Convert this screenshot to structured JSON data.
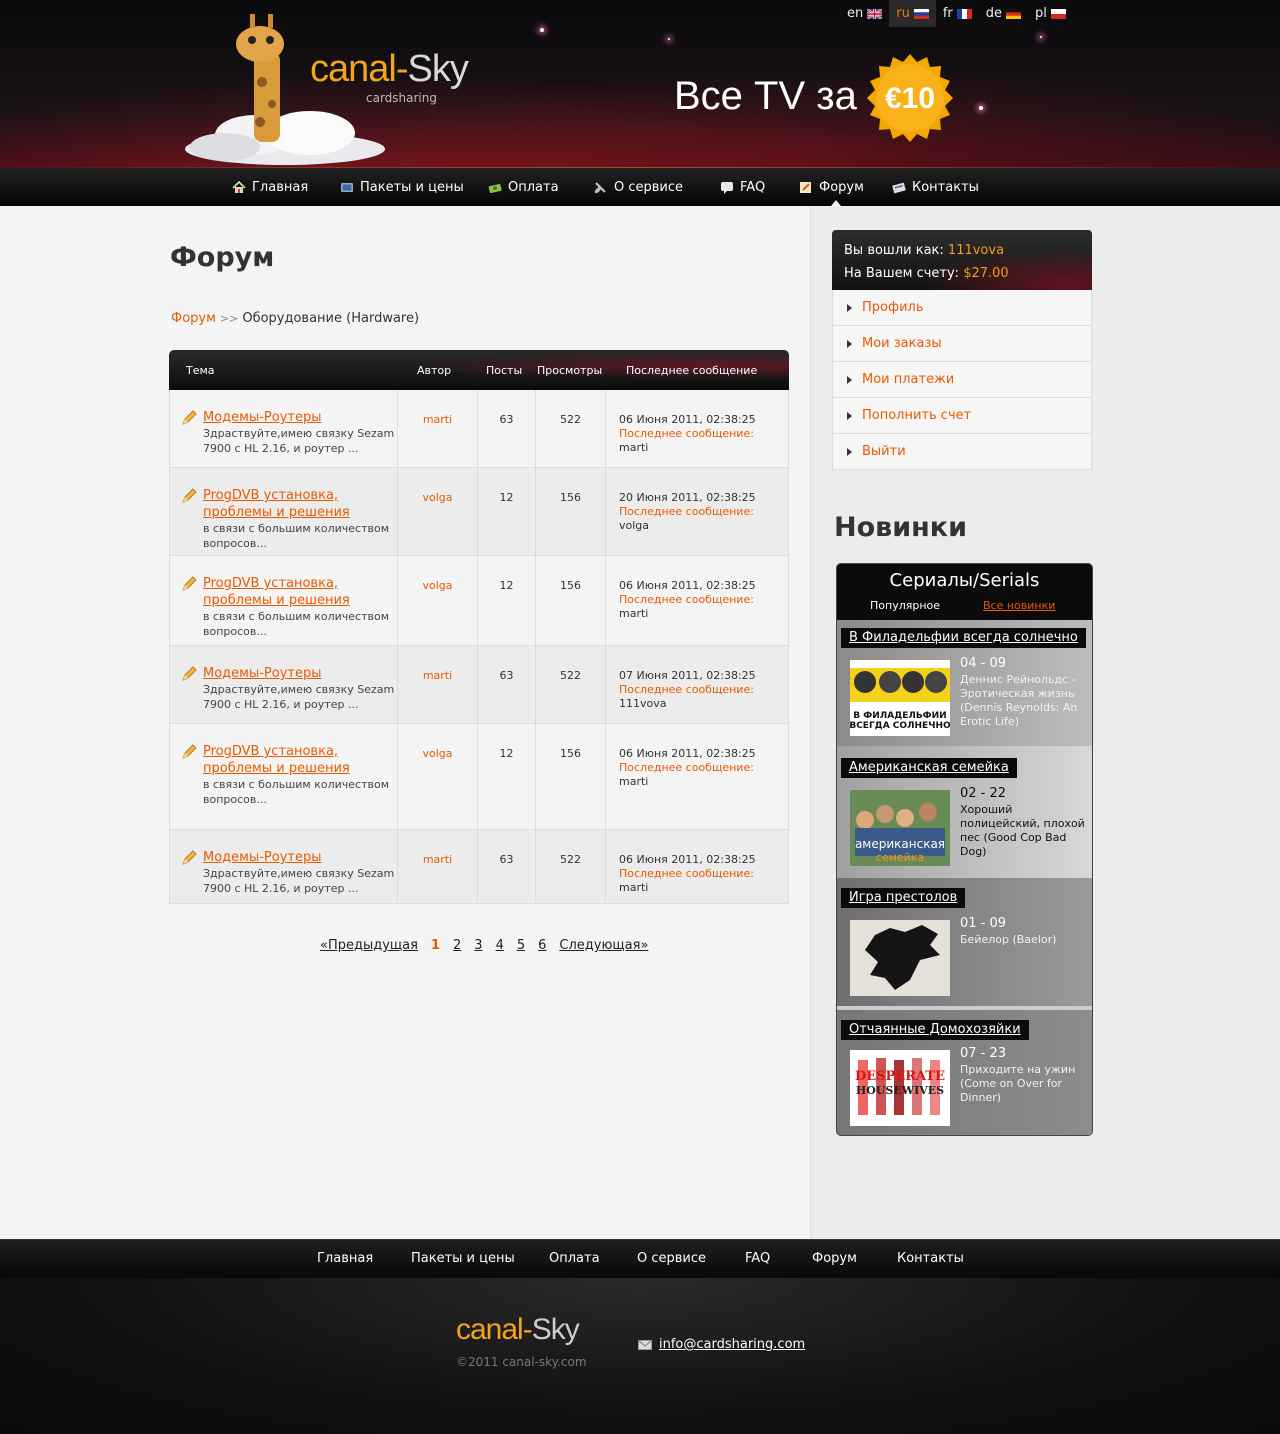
{
  "header": {
    "logo_main": "canal-",
    "logo_accent": "Sky",
    "logo_sub": "cardsharing",
    "promo_text": "Все TV за",
    "price_badge": "€10",
    "languages": [
      {
        "code": "en",
        "active": false
      },
      {
        "code": "ru",
        "active": true
      },
      {
        "code": "fr",
        "active": false
      },
      {
        "code": "de",
        "active": false
      },
      {
        "code": "pl",
        "active": false
      }
    ]
  },
  "nav": {
    "items": [
      {
        "label": "Главная",
        "icon": "home-icon"
      },
      {
        "label": "Пакеты и цены",
        "icon": "tv-icon"
      },
      {
        "label": "Оплата",
        "icon": "money-icon"
      },
      {
        "label": "О сервисе",
        "icon": "satellite-icon"
      },
      {
        "label": "FAQ",
        "icon": "faq-icon"
      },
      {
        "label": "Форум",
        "icon": "forum-icon",
        "active": true
      },
      {
        "label": "Контакты",
        "icon": "contacts-icon"
      }
    ]
  },
  "main": {
    "title": "Форум",
    "breadcrumb": {
      "root": "Форум",
      "sep": ">>",
      "current": "Оборудование (Hardware)"
    },
    "table": {
      "headers": {
        "topic": "Тема",
        "author": "Автор",
        "posts": "Посты",
        "views": "Просмотры",
        "last": "Последнее сообщение"
      },
      "rows": [
        {
          "title": "Модемы-Роутеры",
          "desc": "Здраствуйте,имею связку Sezam 7900 с HL 2.16, и роутер ...",
          "author": "marti",
          "posts": "63",
          "views": "522",
          "date": "06 Июня 2011, 02:38:25",
          "last_label": "Последнее сообщение:",
          "last_user": "marti"
        },
        {
          "title": "ProgDVB установка, проблемы и решения",
          "desc": "в связи с большим количеством вопросов...",
          "author": "volga",
          "posts": "12",
          "views": "156",
          "date": "20 Июня 2011, 02:38:25",
          "last_label": "Последнее сообщение:",
          "last_user": "volga"
        },
        {
          "title": "ProgDVB установка, проблемы и решения",
          "desc": "в связи с большим количеством вопросов...",
          "author": "volga",
          "posts": "12",
          "views": "156",
          "date": "06 Июня 2011, 02:38:25",
          "last_label": "Последнее сообщение:",
          "last_user": "marti"
        },
        {
          "title": "Модемы-Роутеры",
          "desc": "Здраствуйте,имею связку Sezam 7900 с HL 2.16, и роутер ...",
          "author": "marti",
          "posts": "63",
          "views": "522",
          "date": "07 Июня 2011, 02:38:25",
          "last_label": "Последнее сообщение:",
          "last_user": "111vova"
        },
        {
          "title": "ProgDVB установка, проблемы и решения",
          "desc": "в связи с большим количеством вопросов...",
          "author": "volga",
          "posts": "12",
          "views": "156",
          "date": "06 Июня 2011, 02:38:25",
          "last_label": "Последнее сообщение:",
          "last_user": "marti"
        },
        {
          "title": "Модемы-Роутеры",
          "desc": "Здраствуйте,имею связку Sezam 7900 с HL 2.16, и роутер ...",
          "author": "marti",
          "posts": "63",
          "views": "522",
          "date": "06 Июня 2011, 02:38:25",
          "last_label": "Последнее сообщение:",
          "last_user": "marti"
        }
      ]
    },
    "pager": {
      "prev": "«Предыдущая",
      "pages": [
        "1",
        "2",
        "3",
        "4",
        "5",
        "6"
      ],
      "current": "1",
      "next": "Следующая»"
    }
  },
  "sidebar": {
    "account": {
      "logged_label": "Вы вошли как:",
      "user": "111vova",
      "balance_label": "На Вашем счету:",
      "balance": "$27.00"
    },
    "menu": [
      "Профиль",
      "Мои заказы",
      "Мои платежи",
      "Пополнить счет",
      "Выйти"
    ],
    "new_title": "Новинки",
    "serials": {
      "title": "Сериалы/Serials",
      "tab_popular": "Популярное",
      "tab_new": "Все новинки",
      "items": [
        {
          "title": "В Филадельфии всегда солнечно",
          "episode": "04 - 09",
          "name": "Деннис Рейнольдс - Эротическая жизнь (Dennis Reynolds: An Erotic Life)",
          "poster_text": "В ФИЛАДЕЛЬФИИ ВСЕГДА СОЛНЕЧНО"
        },
        {
          "title": "Американская семейка",
          "episode": "02 - 22",
          "name": "Хороший полицейский, плохой пес (Good Cop Bad Dog)",
          "poster_text": "американская семейка"
        },
        {
          "title": "Игра престолов",
          "episode": "01 - 09",
          "name": "Бейелор (Baelor)"
        },
        {
          "title": "Отчаянные Домохозяйки",
          "episode": "07 - 23",
          "name": "Приходите на ужин (Come on Over for Dinner)",
          "poster_text": "DESPERATE HOUSEWIVES"
        }
      ]
    }
  },
  "footer": {
    "nav": [
      "Главная",
      "Пакеты и цены",
      "Оплата",
      "О сервисе",
      "FAQ",
      "Форум",
      "Контакты"
    ],
    "logo_main": "canal-",
    "logo_accent": "Sky",
    "copyright": "©2011  canal-sky.com",
    "email": "info@cardsharing.com"
  }
}
